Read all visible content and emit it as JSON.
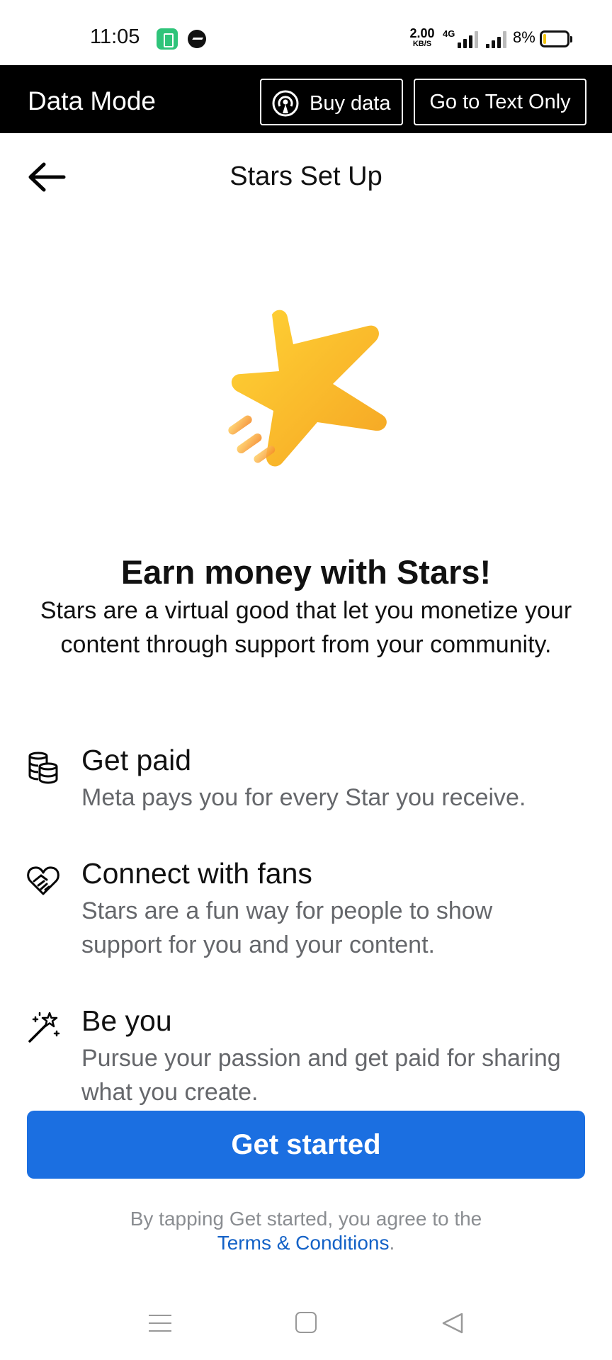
{
  "status_bar": {
    "time": "11:05",
    "net_speed_value": "2.00",
    "net_speed_unit": "KB/S",
    "network_type": "4G",
    "battery_percent": "8%",
    "battery_level": 0.08
  },
  "data_bar": {
    "title": "Data Mode",
    "buy_data_label": "Buy data",
    "text_only_label": "Go to Text Only"
  },
  "header": {
    "title": "Stars Set Up"
  },
  "hero": {
    "headline": "Earn money with Stars!",
    "description": "Stars are a virtual good that let you monetize your content through support from your community."
  },
  "features": [
    {
      "title": "Get paid",
      "description": "Meta pays you for every Star you receive.",
      "icon": "coins-icon"
    },
    {
      "title": "Connect with fans",
      "description": "Stars are a fun way for people to show support for you and your content.",
      "icon": "handshake-heart-icon"
    },
    {
      "title": "Be you",
      "description": "Pursue your passion and get paid for sharing what you create.",
      "icon": "magic-wand-icon"
    }
  ],
  "cta": {
    "label": "Get started"
  },
  "legal": {
    "prefix": "By tapping Get started, you agree to the ",
    "link": "Terms & Conditions",
    "suffix": "."
  },
  "colors": {
    "primary_button": "#1b6fe1",
    "link": "#1462c7",
    "star": "#f7b928",
    "data_bar_bg": "#000000"
  }
}
